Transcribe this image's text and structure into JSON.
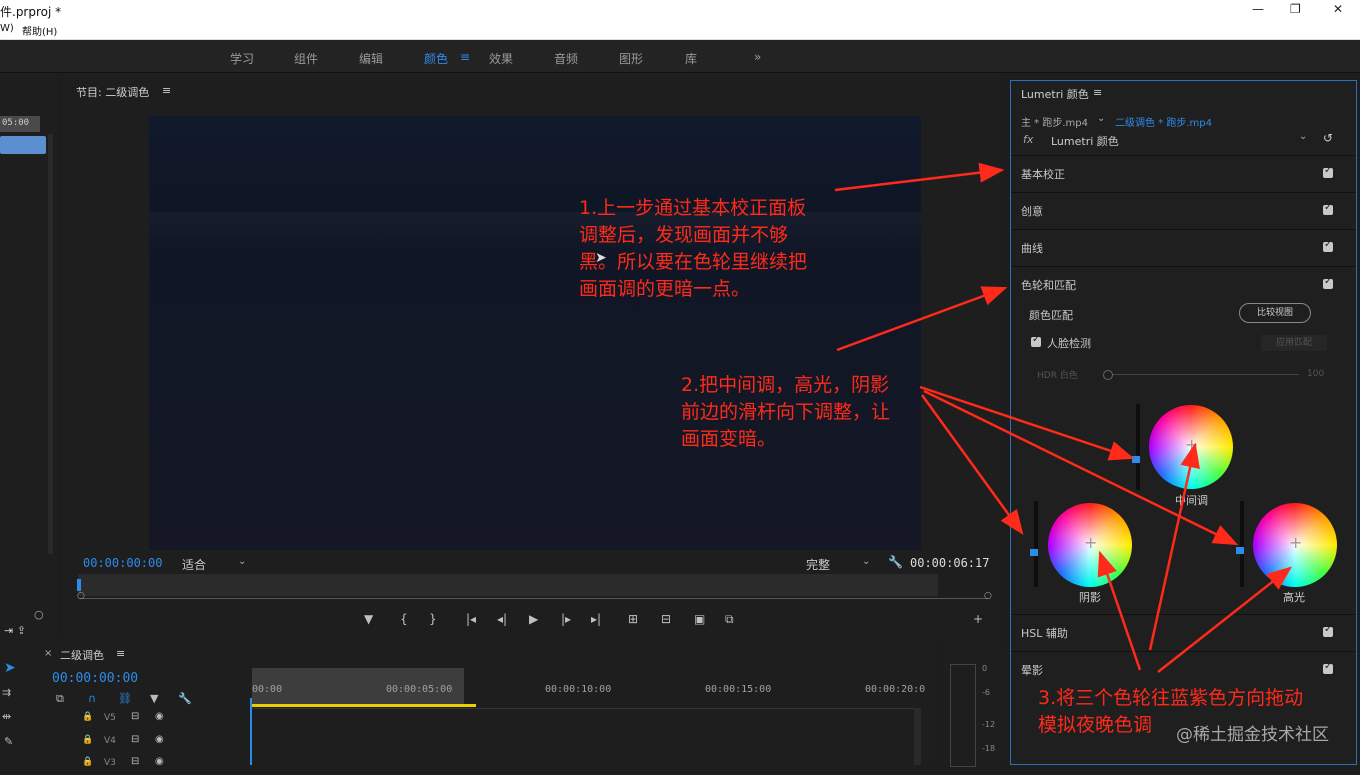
{
  "window": {
    "title": "件.prproj *",
    "minimize_icon": "minimize-icon",
    "restore_icon": "restore-icon",
    "close_icon": "close-icon"
  },
  "menu": {
    "items": [
      "W)",
      "帮助(H)"
    ]
  },
  "workspaces": {
    "items": [
      "学习",
      "组件",
      "编辑",
      "颜色",
      "效果",
      "音频",
      "图形",
      "库"
    ],
    "active": "颜色",
    "more": "»",
    "menu_glyph": "≡"
  },
  "source_panel": {
    "timecode": "05:00"
  },
  "program": {
    "title": "节目: 二级调色",
    "menu_glyph": "≡",
    "timecode_in": "00:00:00:00",
    "fit": "适合",
    "quality": "完整",
    "duration": "00:00:06:17"
  },
  "playback": {
    "controls": [
      "▼",
      "{",
      "}",
      "|◂",
      "◂|",
      "▶",
      "|▸",
      "▸|",
      "⊞",
      "⊟",
      "▣",
      "⧉",
      "+"
    ]
  },
  "lumetri": {
    "title": "Lumetri 颜色",
    "menu_glyph": "≡",
    "master_clip": "主 * 跑步.mp4",
    "sequence_clip": "二级调色 * 跑步.mp4",
    "fx_label": "fx",
    "effect": "Lumetri 颜色",
    "sections": [
      "基本校正",
      "创意",
      "曲线",
      "色轮和匹配"
    ],
    "color_match": "颜色匹配",
    "compare_button": "比较视图",
    "face_detect": "人脸检测",
    "apply_match": "应用匹配",
    "hdr_white": "HDR 白色",
    "hdr_value": "100",
    "hdr_level": 0,
    "wheels": {
      "midtones": "中间调",
      "shadows": "阴影",
      "highlights": "高光"
    },
    "bottom_sections": [
      "HSL 辅助",
      "晕影"
    ]
  },
  "timeline": {
    "title": "二级调色",
    "close_glyph": "×",
    "menu_glyph": "≡",
    "timecode": "00:00:00:00",
    "ruler": [
      "00:00",
      "00:00:05:00",
      "00:00:10:00",
      "00:00:15:00",
      "00:00:20:0"
    ],
    "tracks": [
      "V5",
      "V4",
      "V3"
    ]
  },
  "meter": {
    "labels": [
      "0",
      "-6",
      "-12",
      "-18"
    ]
  },
  "annotations": {
    "note1": [
      "1.上一步通过基本校正面板",
      "调整后，发现画面并不够",
      "黑。所以要在色轮里继续把",
      "画面调的更暗一点。"
    ],
    "note2": [
      "2.把中间调，高光，阴影",
      "前边的滑杆向下调整，让",
      "画面变暗。"
    ],
    "note3": [
      "3.将三个色轮往蓝紫色方向拖动",
      "模拟夜晚色调"
    ]
  },
  "watermark": "@稀土掘金技术社区",
  "colors": {
    "accent": "#2d8ceb",
    "annotation": "#ff2a1a",
    "panel_border": "#2d6fbf"
  }
}
